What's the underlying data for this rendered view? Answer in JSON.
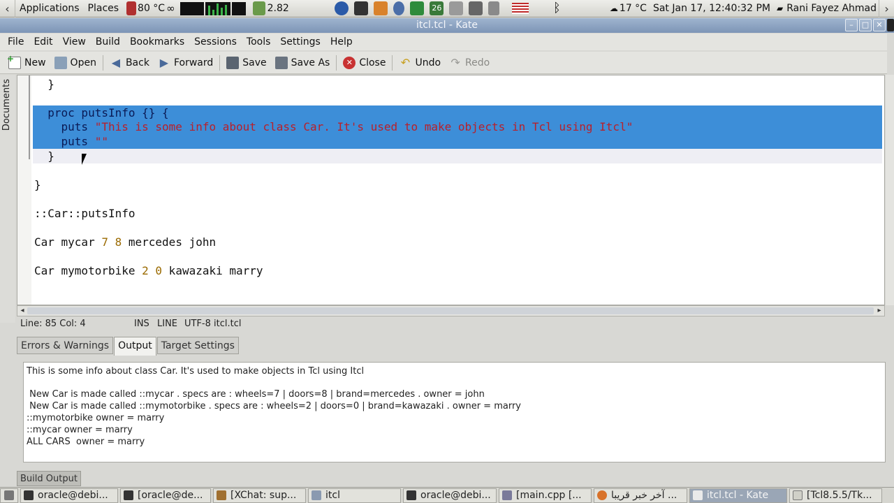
{
  "top_panel": {
    "applications": "Applications",
    "places": "Places",
    "cpu_temp": "80 °C",
    "battery": "2.82",
    "calendar_day": "26",
    "weather": "17 °C",
    "datetime": "Sat Jan 17, 12:40:32 PM",
    "user": "Rani Fayez Ahmad"
  },
  "window": {
    "title": "itcl.tcl - Kate"
  },
  "menu": [
    "File",
    "Edit",
    "View",
    "Build",
    "Bookmarks",
    "Sessions",
    "Tools",
    "Settings",
    "Help"
  ],
  "toolbar": {
    "new": "New",
    "open": "Open",
    "back": "Back",
    "forward": "Forward",
    "save": "Save",
    "save_as": "Save As",
    "close": "Close",
    "undo": "Undo",
    "redo": "Redo"
  },
  "sidebar": {
    "documents_tab": "Documents"
  },
  "editor": {
    "line1": "  }",
    "line3_a": "  proc putsInfo {} {",
    "line4_kw": "    puts ",
    "line4_str": "\"This is some info about class Car. It's used to make objects in Tcl using Itcl\"",
    "line5_kw": "    puts ",
    "line5_str": "\"\"",
    "line6": "  }",
    "line8": "}",
    "line10": "::Car::putsInfo",
    "line12_a": "Car mycar ",
    "line12_n1": "7",
    "line12_n2": "8",
    "line12_b": " mercedes john",
    "line14_a": "Car mymotorbike ",
    "line14_n1": "2",
    "line14_n2": "0",
    "line14_b": " kawazaki marry"
  },
  "status": {
    "position": "Line: 85 Col: 4",
    "mode": "INS",
    "select_mode": "LINE",
    "encoding_file": "UTF-8 itcl.tcl"
  },
  "output_tabs": [
    "Errors & Warnings",
    "Output",
    "Target Settings"
  ],
  "output_lines": [
    "This is some info about class Car. It's used to make objects in Tcl using Itcl",
    " New Car is made called ::mycar . specs are : wheels=7 | doors=8 | brand=mercedes . owner = john",
    " New Car is made called ::mymotorbike . specs are : wheels=2 | doors=0 | brand=kawazaki . owner = marry",
    "::mymotorbike owner = marry",
    "::mycar owner = marry",
    "ALL CARS  owner = marry"
  ],
  "build_output": "Build Output",
  "taskbar": [
    "oracle@debi...",
    "[oracle@de...",
    "[XChat: sup...",
    "itcl",
    "oracle@debi...",
    "[main.cpp [...",
    "آخر خبر قريبا ...",
    "itcl.tcl - Kate",
    "[Tcl8.5.5/Tk..."
  ]
}
